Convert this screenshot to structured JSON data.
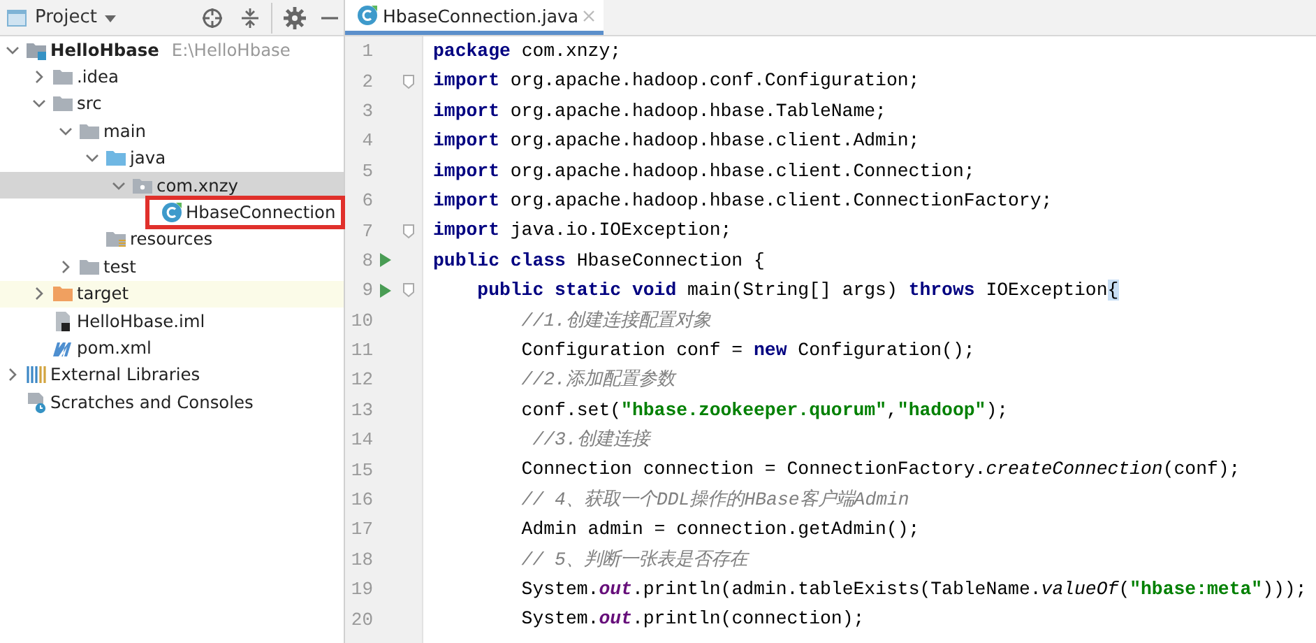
{
  "project_panel": {
    "title": "Project",
    "tree": [
      {
        "label": "HelloHbase",
        "kind": "module",
        "path": "E:\\HelloHbase",
        "expanded": true,
        "selected": false,
        "children": [
          {
            "label": ".idea",
            "kind": "folder",
            "expanded": false,
            "selected": false
          },
          {
            "label": "src",
            "kind": "folder",
            "expanded": true,
            "selected": false,
            "children": [
              {
                "label": "main",
                "kind": "folder",
                "expanded": true,
                "selected": false,
                "children": [
                  {
                    "label": "java",
                    "kind": "sources",
                    "expanded": true,
                    "selected": false,
                    "children": [
                      {
                        "label": "com.xnzy",
                        "kind": "package",
                        "expanded": true,
                        "selected": true,
                        "children": [
                          {
                            "label": "HbaseConnection",
                            "kind": "class",
                            "selected": false,
                            "annotated": true
                          }
                        ]
                      }
                    ]
                  },
                  {
                    "label": "resources",
                    "kind": "resources",
                    "selected": false
                  }
                ]
              },
              {
                "label": "test",
                "kind": "folder",
                "expanded": false,
                "selected": false
              }
            ]
          },
          {
            "label": "target",
            "kind": "excluded",
            "expanded": false,
            "selected": false,
            "highlighted": true
          },
          {
            "label": "HelloHbase.iml",
            "kind": "iml",
            "selected": false
          },
          {
            "label": "pom.xml",
            "kind": "maven",
            "selected": false
          }
        ]
      },
      {
        "label": "External Libraries",
        "kind": "libraries",
        "expanded": false,
        "selected": false
      },
      {
        "label": "Scratches and Consoles",
        "kind": "scratches",
        "selected": false
      }
    ]
  },
  "editor": {
    "tabs": [
      {
        "label": "HbaseConnection.java",
        "selected": true
      }
    ],
    "lines": [
      {
        "number": "1",
        "run": false,
        "fold": false,
        "tokens": [
          {
            "kind": "keyword",
            "text": "package"
          },
          {
            "kind": "plain",
            "text": " com.xnzy;"
          }
        ]
      },
      {
        "number": "2",
        "run": false,
        "fold": true,
        "tokens": [
          {
            "kind": "keyword",
            "text": "import"
          },
          {
            "kind": "plain",
            "text": " org.apache.hadoop.conf.Configuration;"
          }
        ]
      },
      {
        "number": "3",
        "run": false,
        "fold": false,
        "tokens": [
          {
            "kind": "keyword",
            "text": "import"
          },
          {
            "kind": "plain",
            "text": " org.apache.hadoop.hbase.TableName;"
          }
        ]
      },
      {
        "number": "4",
        "run": false,
        "fold": false,
        "tokens": [
          {
            "kind": "keyword",
            "text": "import"
          },
          {
            "kind": "plain",
            "text": " org.apache.hadoop.hbase.client.Admin;"
          }
        ]
      },
      {
        "number": "5",
        "run": false,
        "fold": false,
        "tokens": [
          {
            "kind": "keyword",
            "text": "import"
          },
          {
            "kind": "plain",
            "text": " org.apache.hadoop.hbase.client.Connection;"
          }
        ]
      },
      {
        "number": "6",
        "run": false,
        "fold": false,
        "tokens": [
          {
            "kind": "keyword",
            "text": "import"
          },
          {
            "kind": "plain",
            "text": " org.apache.hadoop.hbase.client.ConnectionFactory;"
          }
        ]
      },
      {
        "number": "7",
        "run": false,
        "fold": true,
        "tokens": [
          {
            "kind": "keyword",
            "text": "import"
          },
          {
            "kind": "plain",
            "text": " java.io.IOException;"
          }
        ]
      },
      {
        "number": "8",
        "run": true,
        "fold": false,
        "tokens": [
          {
            "kind": "keyword",
            "text": "public class"
          },
          {
            "kind": "plain",
            "text": " HbaseConnection {"
          }
        ]
      },
      {
        "number": "9",
        "run": true,
        "fold": true,
        "tokens": [
          {
            "kind": "keyword",
            "text": "    public static void"
          },
          {
            "kind": "plain",
            "text": " main(String[] args) "
          },
          {
            "kind": "keyword",
            "text": "throws"
          },
          {
            "kind": "plain",
            "text": " IOException"
          },
          {
            "kind": "brace",
            "text": "{"
          }
        ]
      },
      {
        "number": "10",
        "run": false,
        "fold": false,
        "tokens": [
          {
            "kind": "comment",
            "text": "        //1.创建连接配置对象"
          }
        ]
      },
      {
        "number": "11",
        "run": false,
        "fold": false,
        "tokens": [
          {
            "kind": "plain",
            "text": "        Configuration conf = "
          },
          {
            "kind": "keyword",
            "text": "new"
          },
          {
            "kind": "plain",
            "text": " Configuration();"
          }
        ]
      },
      {
        "number": "12",
        "run": false,
        "fold": false,
        "tokens": [
          {
            "kind": "comment",
            "text": "        //2.添加配置参数"
          }
        ]
      },
      {
        "number": "13",
        "run": false,
        "fold": false,
        "tokens": [
          {
            "kind": "plain",
            "text": "        conf.set("
          },
          {
            "kind": "string",
            "text": "\"hbase.zookeeper.quorum\""
          },
          {
            "kind": "plain",
            "text": ","
          },
          {
            "kind": "string",
            "text": "\"hadoop\""
          },
          {
            "kind": "plain",
            "text": ");"
          }
        ]
      },
      {
        "number": "14",
        "run": false,
        "fold": false,
        "tokens": [
          {
            "kind": "comment",
            "text": "         //3.创建连接"
          }
        ]
      },
      {
        "number": "15",
        "run": false,
        "fold": false,
        "tokens": [
          {
            "kind": "plain",
            "text": "        Connection connection = ConnectionFactory."
          },
          {
            "kind": "method",
            "text": "createConnection"
          },
          {
            "kind": "plain",
            "text": "(conf);"
          }
        ]
      },
      {
        "number": "16",
        "run": false,
        "fold": false,
        "tokens": [
          {
            "kind": "comment",
            "text": "        // 4、获取一个DDL操作的HBase客户端Admin"
          }
        ]
      },
      {
        "number": "17",
        "run": false,
        "fold": false,
        "tokens": [
          {
            "kind": "plain",
            "text": "        Admin admin = connection.getAdmin();"
          }
        ]
      },
      {
        "number": "18",
        "run": false,
        "fold": false,
        "tokens": [
          {
            "kind": "comment",
            "text": "        // 5、判断一张表是否存在"
          }
        ]
      },
      {
        "number": "19",
        "run": false,
        "fold": false,
        "tokens": [
          {
            "kind": "plain",
            "text": "        System."
          },
          {
            "kind": "field",
            "text": "out"
          },
          {
            "kind": "plain",
            "text": ".println(admin.tableExists(TableName."
          },
          {
            "kind": "method",
            "text": "valueOf"
          },
          {
            "kind": "plain",
            "text": "("
          },
          {
            "kind": "string",
            "text": "\"hbase:meta\""
          },
          {
            "kind": "plain",
            "text": ")));"
          }
        ]
      },
      {
        "number": "20",
        "run": false,
        "fold": false,
        "tokens": [
          {
            "kind": "plain",
            "text": "        System."
          },
          {
            "kind": "field",
            "text": "out"
          },
          {
            "kind": "plain",
            "text": ".println(connection);"
          }
        ]
      }
    ]
  }
}
